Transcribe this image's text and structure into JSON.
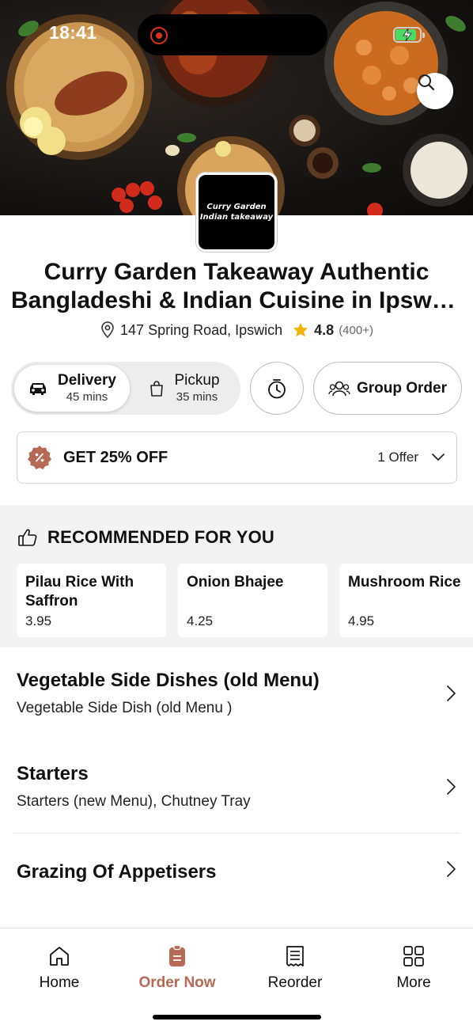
{
  "status_bar": {
    "time": "18:41"
  },
  "restaurant": {
    "logo_line1": "Curry Garden",
    "logo_line2": "Indian takeaway",
    "name_line1": "Curry Garden Takeaway Authentic",
    "name_line2": "Bangladeshi & Indian Cuisine in Ipswic...",
    "address": "147 Spring Road, Ipswich",
    "rating": "4.8",
    "rating_count": "(400+)"
  },
  "order_mode": {
    "delivery": {
      "label": "Delivery",
      "time": "45 mins",
      "icon": "car-icon"
    },
    "pickup": {
      "label": "Pickup",
      "time": "35 mins",
      "icon": "bag-icon"
    },
    "selected": "delivery"
  },
  "group_order": {
    "label": "Group Order"
  },
  "offer": {
    "title": "GET 25% OFF",
    "count": "1 Offer"
  },
  "recommended": {
    "heading": "RECOMMENDED FOR YOU",
    "items": [
      {
        "name": "Pilau Rice With Saffron",
        "price": "3.95"
      },
      {
        "name": "Onion Bhajee",
        "price": "4.25"
      },
      {
        "name": "Mushroom Rice",
        "price": "4.95"
      }
    ]
  },
  "categories": [
    {
      "title": "Vegetable Side Dishes (old Menu)",
      "subtitle": "Vegetable Side Dish (old Menu )"
    },
    {
      "title": "Starters",
      "subtitle": "Starters (new Menu), Chutney Tray"
    },
    {
      "title": "Grazing Of Appetisers",
      "subtitle": ""
    }
  ],
  "tabs": [
    {
      "label": "Home",
      "icon": "home-icon"
    },
    {
      "label": "Order Now",
      "icon": "order-icon"
    },
    {
      "label": "Reorder",
      "icon": "receipt-icon"
    },
    {
      "label": "More",
      "icon": "grid-icon"
    }
  ],
  "colors": {
    "accent": "#b66a55",
    "star": "#f5b301",
    "rec": "#e0301e",
    "battery": "#4cd964"
  }
}
